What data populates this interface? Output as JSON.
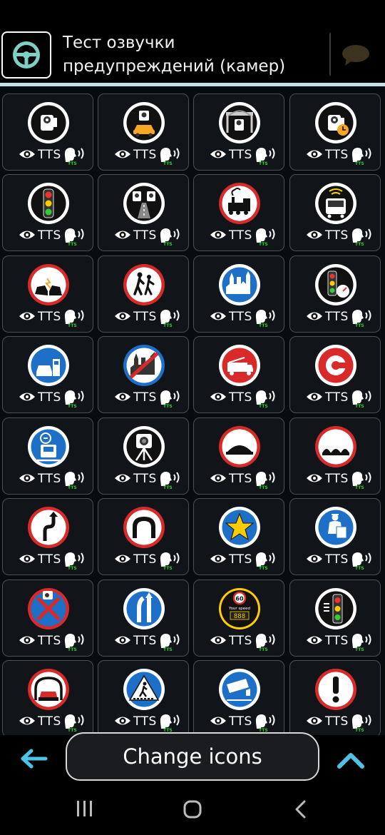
{
  "header": {
    "title": "Тест озвучки предупреждений (камер)",
    "app_icon": "steering-wheel-icon",
    "chat_icon": "chat-bubble-icon"
  },
  "tile_controls": {
    "tts_label": "TTS",
    "tts_badge": "TTS"
  },
  "tiles": [
    {
      "icon": "speed-camera-icon"
    },
    {
      "icon": "car-camera-icon"
    },
    {
      "icon": "bridge-camera-icon"
    },
    {
      "icon": "timer-camera-icon"
    },
    {
      "icon": "traffic-light-icon"
    },
    {
      "icon": "lane-camera-icon"
    },
    {
      "icon": "railway-crossing-icon"
    },
    {
      "icon": "bus-lane-camera-icon"
    },
    {
      "icon": "car-crash-icon"
    },
    {
      "icon": "children-crossing-icon"
    },
    {
      "icon": "city-entrance-icon"
    },
    {
      "icon": "traffic-light-speed-icon"
    },
    {
      "icon": "gas-station-icon"
    },
    {
      "icon": "city-end-icon"
    },
    {
      "icon": "fire-truck-icon"
    },
    {
      "icon": "toll-road-icon"
    },
    {
      "icon": "truck-weight-icon"
    },
    {
      "icon": "tripod-camera-icon"
    },
    {
      "icon": "speed-bump-icon"
    },
    {
      "icon": "rough-road-icon"
    },
    {
      "icon": "double-curve-icon"
    },
    {
      "icon": "tunnel-icon"
    },
    {
      "icon": "favorite-star-icon"
    },
    {
      "icon": "police-post-icon"
    },
    {
      "icon": "no-parking-camera-icon"
    },
    {
      "icon": "road-merge-icon"
    },
    {
      "icon": "your-speed-display-icon",
      "speed_limit": "60",
      "caption": "Your speed",
      "digits": "888"
    },
    {
      "icon": "traffic-light-alert-icon"
    },
    {
      "icon": "tunnel-car-icon"
    },
    {
      "icon": "pedestrian-crossing-icon"
    },
    {
      "icon": "surveillance-camera-icon"
    },
    {
      "icon": "exclamation-warning-icon"
    }
  ],
  "bottom_bar": {
    "change_icons_label": "Change icons",
    "back_icon": "arrow-left-icon",
    "expand_icon": "chevron-up-icon"
  },
  "system_nav": {
    "recent_icon": "recent-apps-icon",
    "home_icon": "home-icon",
    "back_icon": "back-icon"
  },
  "colors": {
    "tile_bg": "#111519",
    "tile_border": "#4a5058",
    "accent": "#c8dce4",
    "tts_badge": "#2ed12e",
    "sign_red": "#d92a2a",
    "sign_blue": "#1e6fc8",
    "back_arrow": "#4fc3e6"
  }
}
